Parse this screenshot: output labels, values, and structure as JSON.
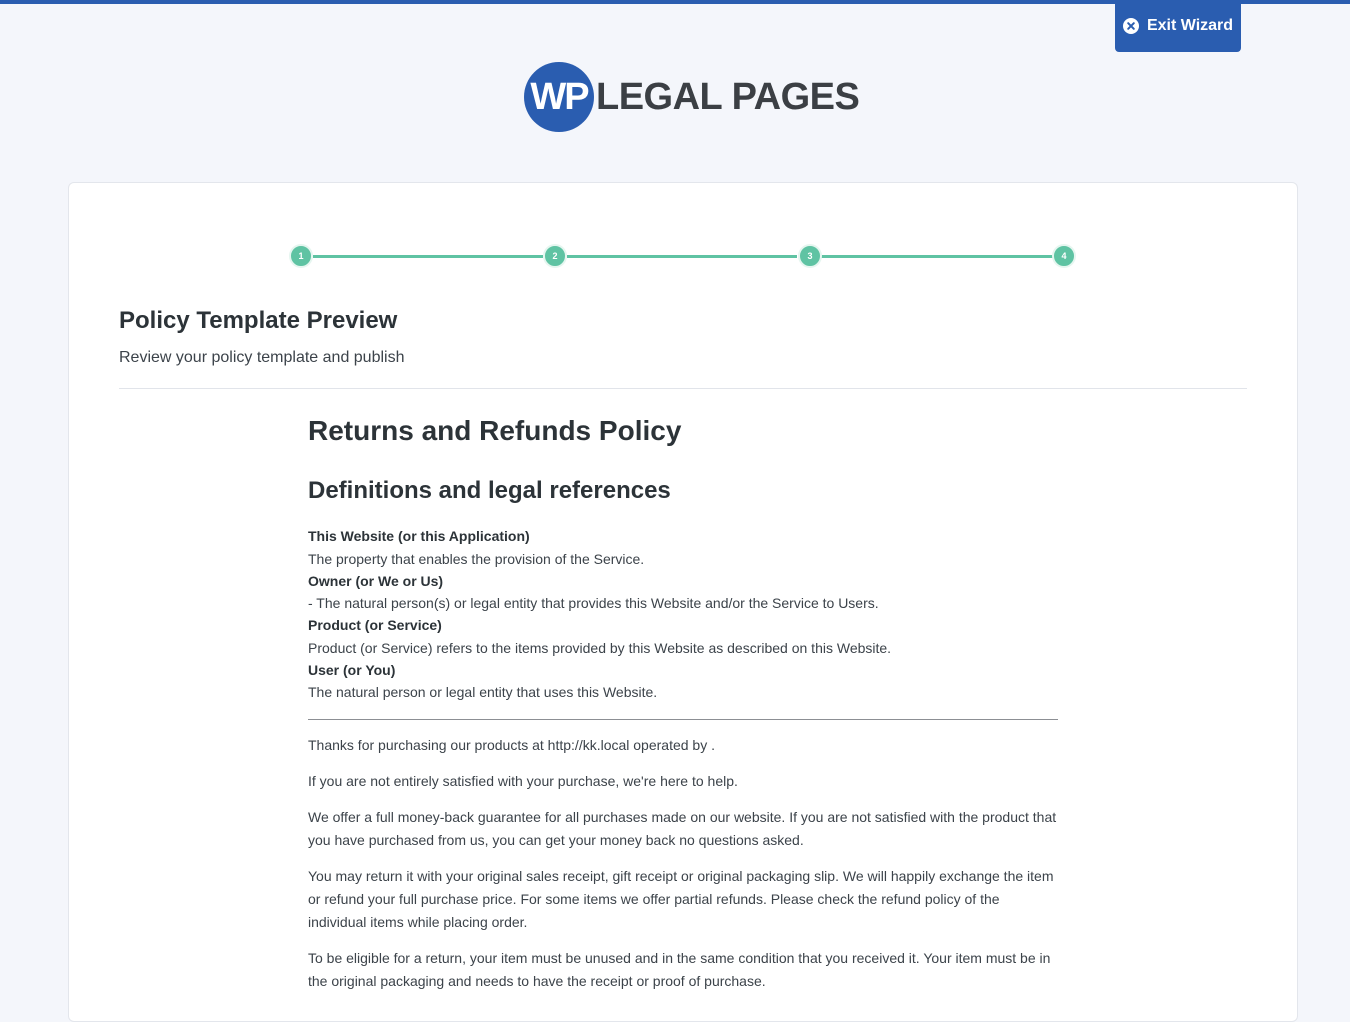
{
  "header": {
    "exit_label": "Exit Wizard",
    "exit_icon": "close-circle-icon",
    "accent_color": "#2a5db0"
  },
  "logo": {
    "circle_text": "WP",
    "text": "LEGAL PAGES"
  },
  "stepper": {
    "color": "#5fc3a3",
    "steps": [
      "1",
      "2",
      "3",
      "4"
    ]
  },
  "section": {
    "title": "Policy Template Preview",
    "subtitle": "Review your policy template and publish"
  },
  "policy": {
    "title": "Returns and Refunds Policy",
    "definitions_heading": "Definitions and legal references",
    "definitions": [
      {
        "term": "This Website (or this Application)",
        "description": "The property that enables the provision of the Service."
      },
      {
        "term": "Owner (or We or Us)",
        "description": "- The natural person(s) or legal entity that provides this Website and/or the Service to Users."
      },
      {
        "term": "Product (or Service)",
        "description": "Product (or Service) refers to the items provided by this Website as described on this Website."
      },
      {
        "term": "User (or You)",
        "description": "The natural person or legal entity that uses this Website."
      }
    ],
    "paragraphs": [
      "Thanks for purchasing our products at http://kk.local operated by .",
      "If you are not entirely satisfied with your purchase, we're here to help.",
      "We offer a full money-back guarantee for all purchases made on our website. If you are not satisfied with the product that you have purchased from us, you can get your money back no questions asked.",
      "You may return it with your original sales receipt, gift receipt or original packaging slip. We will happily exchange the item or refund your full purchase price. For some items we offer partial refunds. Please check the refund policy of the individual items while placing order.",
      "To be eligible for a return, your item must be unused and in the same condition that you received it. Your item must be in the original packaging and needs to have the receipt or proof of purchase."
    ]
  }
}
